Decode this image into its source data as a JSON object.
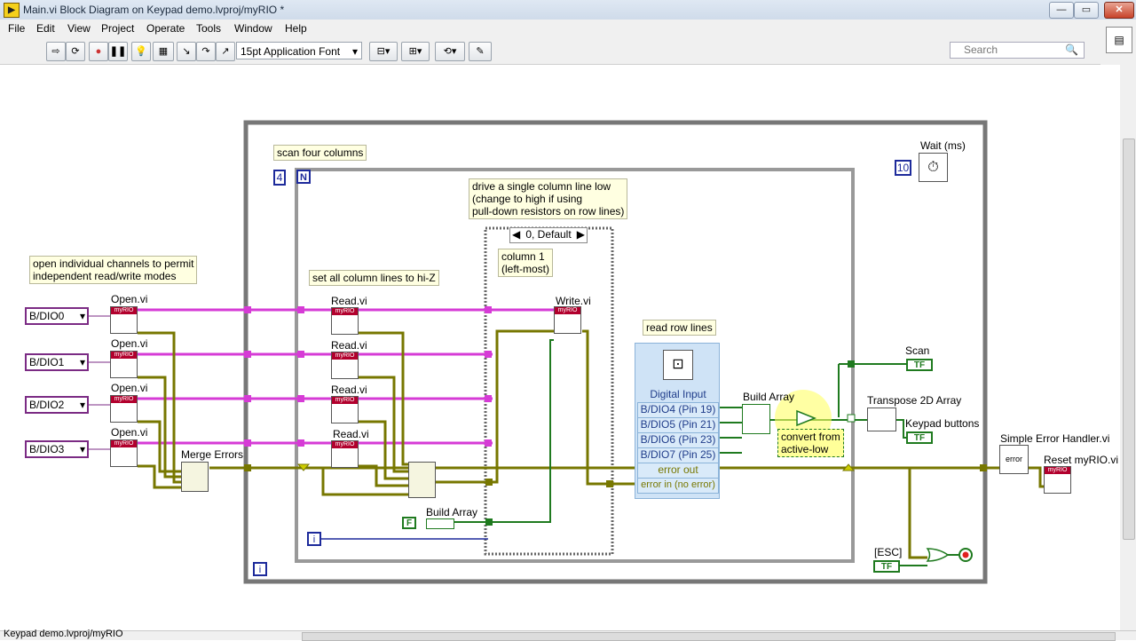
{
  "window": {
    "title": "Main.vi Block Diagram on Keypad demo.lvproj/myRIO *"
  },
  "menu": [
    "File",
    "Edit",
    "View",
    "Project",
    "Operate",
    "Tools",
    "Window",
    "Help"
  ],
  "toolbar": {
    "font": "15pt Application Font"
  },
  "search": {
    "placeholder": "Search"
  },
  "diagram": {
    "notes": {
      "scan_columns": "scan four columns",
      "open_channels_1": "open individual channels to permit",
      "open_channels_2": "independent read/write modes",
      "hiz": "set all column lines to hi-Z",
      "drive_1": "drive a single column line low",
      "drive_2": "(change to high if using",
      "drive_3": "pull-down resistors on row lines)",
      "column_1": "column 1",
      "column_2": "(left-most)",
      "read_rows": "read row lines",
      "convert_1": "convert from",
      "convert_2": "active-low"
    },
    "channels": [
      "B/DIO0",
      "B/DIO1",
      "B/DIO2",
      "B/DIO3"
    ],
    "labels": {
      "open": "Open.vi",
      "read": "Read.vi",
      "write": "Write.vi",
      "merge": "Merge Errors",
      "build_array": "Build Array",
      "build_array2": "Build Array",
      "wait": "Wait (ms)",
      "scan": "Scan",
      "transpose": "Transpose 2D Array",
      "keypad": "Keypad buttons",
      "error_handler": "Simple Error Handler.vi",
      "reset": "Reset myRIO.vi",
      "esc": "[ESC]"
    },
    "case_selector": "0, Default",
    "loop_count": "4",
    "wait_value": "10",
    "false_const": "F",
    "digital_input": {
      "title": "Digital Input",
      "rows": [
        "B/DIO4 (Pin 19)",
        "B/DIO5 (Pin 21)",
        "B/DIO6 (Pin 23)",
        "B/DIO7 (Pin 25)",
        "error out",
        "error in (no error)"
      ]
    }
  },
  "status": {
    "text": "Keypad demo.lvproj/myRIO"
  }
}
